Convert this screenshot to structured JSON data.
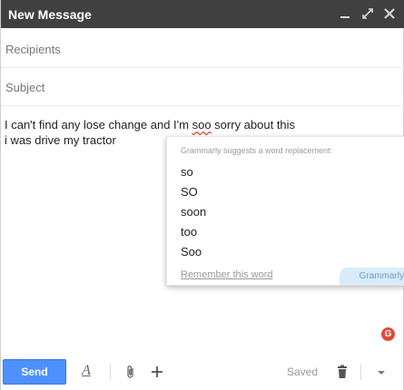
{
  "window": {
    "title": "New Message"
  },
  "fields": {
    "recipients_placeholder": "Recipients",
    "subject_placeholder": "Subject"
  },
  "body": {
    "line1_before": "I can't find any lose change and I'm ",
    "line1_misspelled": "soo",
    "line1_after": " sorry about this",
    "line2": "i was drive my tractor"
  },
  "grammarly": {
    "header": "Grammarly suggests a word replacement:",
    "suggestions": [
      "so",
      "SO",
      "soon",
      "too",
      "Soo"
    ],
    "remember_label": "Remember this word",
    "brand_label": "Grammarly",
    "badge_letter": "G",
    "accent_color": "#dd4b39",
    "tab_color": "#d9ecf9"
  },
  "toolbar": {
    "send_label": "Send",
    "format_label": "A",
    "saved_label": "Saved",
    "icons": [
      "formatting-icon",
      "attach-icon",
      "insert-more-icon",
      "trash-icon",
      "more-options-icon"
    ]
  },
  "colors": {
    "titlebar": "#404040",
    "send_button": "#4d90fe"
  }
}
